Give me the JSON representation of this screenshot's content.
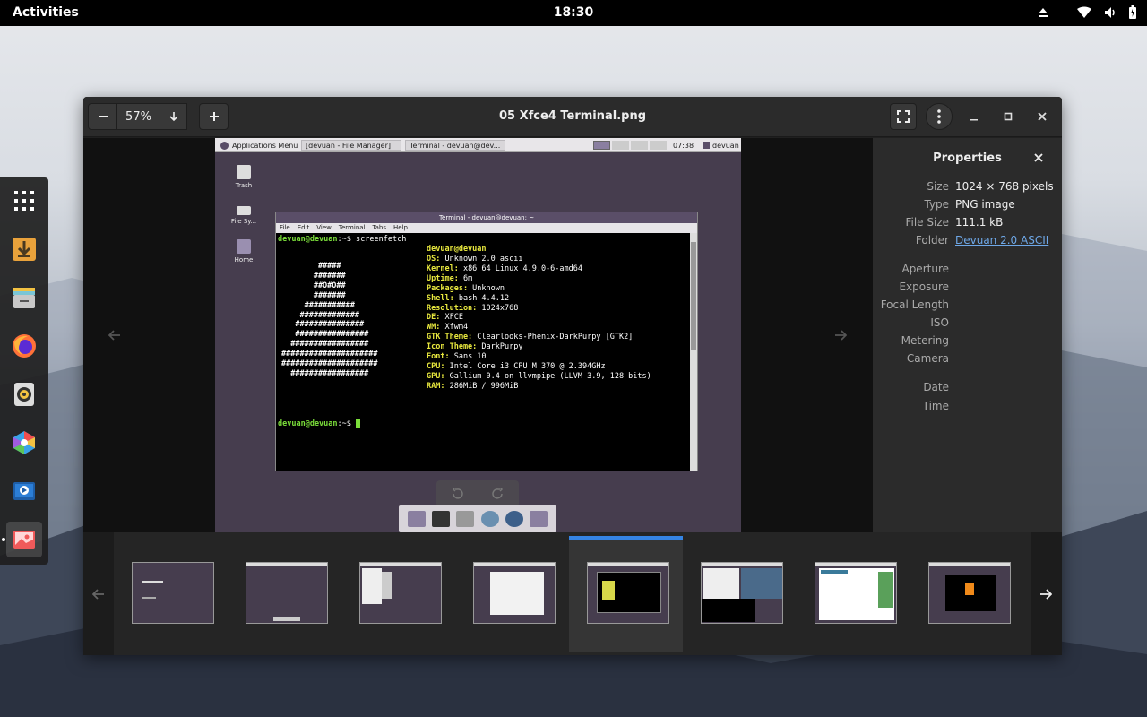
{
  "topbar": {
    "activities": "Activities",
    "clock": "18:30"
  },
  "viewer": {
    "title": "05 Xfce4 Terminal.png",
    "zoom": "57%"
  },
  "shot": {
    "panel": {
      "apps": "Applications Menu",
      "task1": "[devuan - File Manager]",
      "task2": "Terminal - devuan@dev...",
      "time": "07:38",
      "user": "devuan"
    },
    "desktop": {
      "trash": "Trash",
      "filesys": "File Sy...",
      "home": "Home"
    },
    "terminal": {
      "title": "Terminal - devuan@devuan: ~",
      "menu": [
        "File",
        "Edit",
        "View",
        "Terminal",
        "Tabs",
        "Help"
      ],
      "prompt": "devuan@devuan",
      "prompt_rest": ":~$ ",
      "command": "screenfetch",
      "host": "devuan@devuan",
      "info": [
        {
          "k": "OS:",
          "v": " Unknown 2.0 ascii"
        },
        {
          "k": "Kernel:",
          "v": " x86_64 Linux 4.9.0-6-amd64"
        },
        {
          "k": "Uptime:",
          "v": " 6m"
        },
        {
          "k": "Packages:",
          "v": " Unknown"
        },
        {
          "k": "Shell:",
          "v": " bash 4.4.12"
        },
        {
          "k": "Resolution:",
          "v": " 1024x768"
        },
        {
          "k": "DE:",
          "v": " XFCE"
        },
        {
          "k": "WM:",
          "v": " Xfwm4"
        },
        {
          "k": "GTK Theme:",
          "v": " Clearlooks-Phenix-DarkPurpy [GTK2]"
        },
        {
          "k": "Icon Theme:",
          "v": " DarkPurpy"
        },
        {
          "k": "Font:",
          "v": " Sans 10"
        },
        {
          "k": "CPU:",
          "v": " Intel Core i3 CPU M 370 @ 2.394GHz"
        },
        {
          "k": "GPU:",
          "v": " Gallium 0.4 on llvmpipe (LLVM 3.9, 128 bits)"
        },
        {
          "k": "RAM:",
          "v": " 286MiB / 996MiB"
        }
      ],
      "ascii": [
        "        #####",
        "       #######",
        "       ##O#O##",
        "       #######",
        "     ###########",
        "    #############",
        "   ###############",
        "   ################",
        "  #################",
        "#####################",
        "#####################",
        "  #################"
      ]
    }
  },
  "properties": {
    "title": "Properties",
    "rows": [
      {
        "label": "Size",
        "value": "1024 × 768 pixels"
      },
      {
        "label": "Type",
        "value": "PNG image"
      },
      {
        "label": "File Size",
        "value": "111.1 kB"
      },
      {
        "label": "Folder",
        "value": "Devuan 2.0 ASCII"
      }
    ],
    "exif": [
      "Aperture",
      "Exposure",
      "Focal Length",
      "ISO",
      "Metering",
      "Camera"
    ],
    "time": [
      "Date",
      "Time"
    ]
  },
  "colors": {
    "accent": "#3584e4",
    "link": "#6ea8e8",
    "prompt": "#7bde3a",
    "key": "#e8e83e"
  },
  "dock_icons": [
    "app-grid-icon",
    "download-icon",
    "files-icon",
    "firefox-icon",
    "rhythmbox-icon",
    "hexagon-app-icon",
    "video-icon",
    "image-viewer-icon"
  ]
}
